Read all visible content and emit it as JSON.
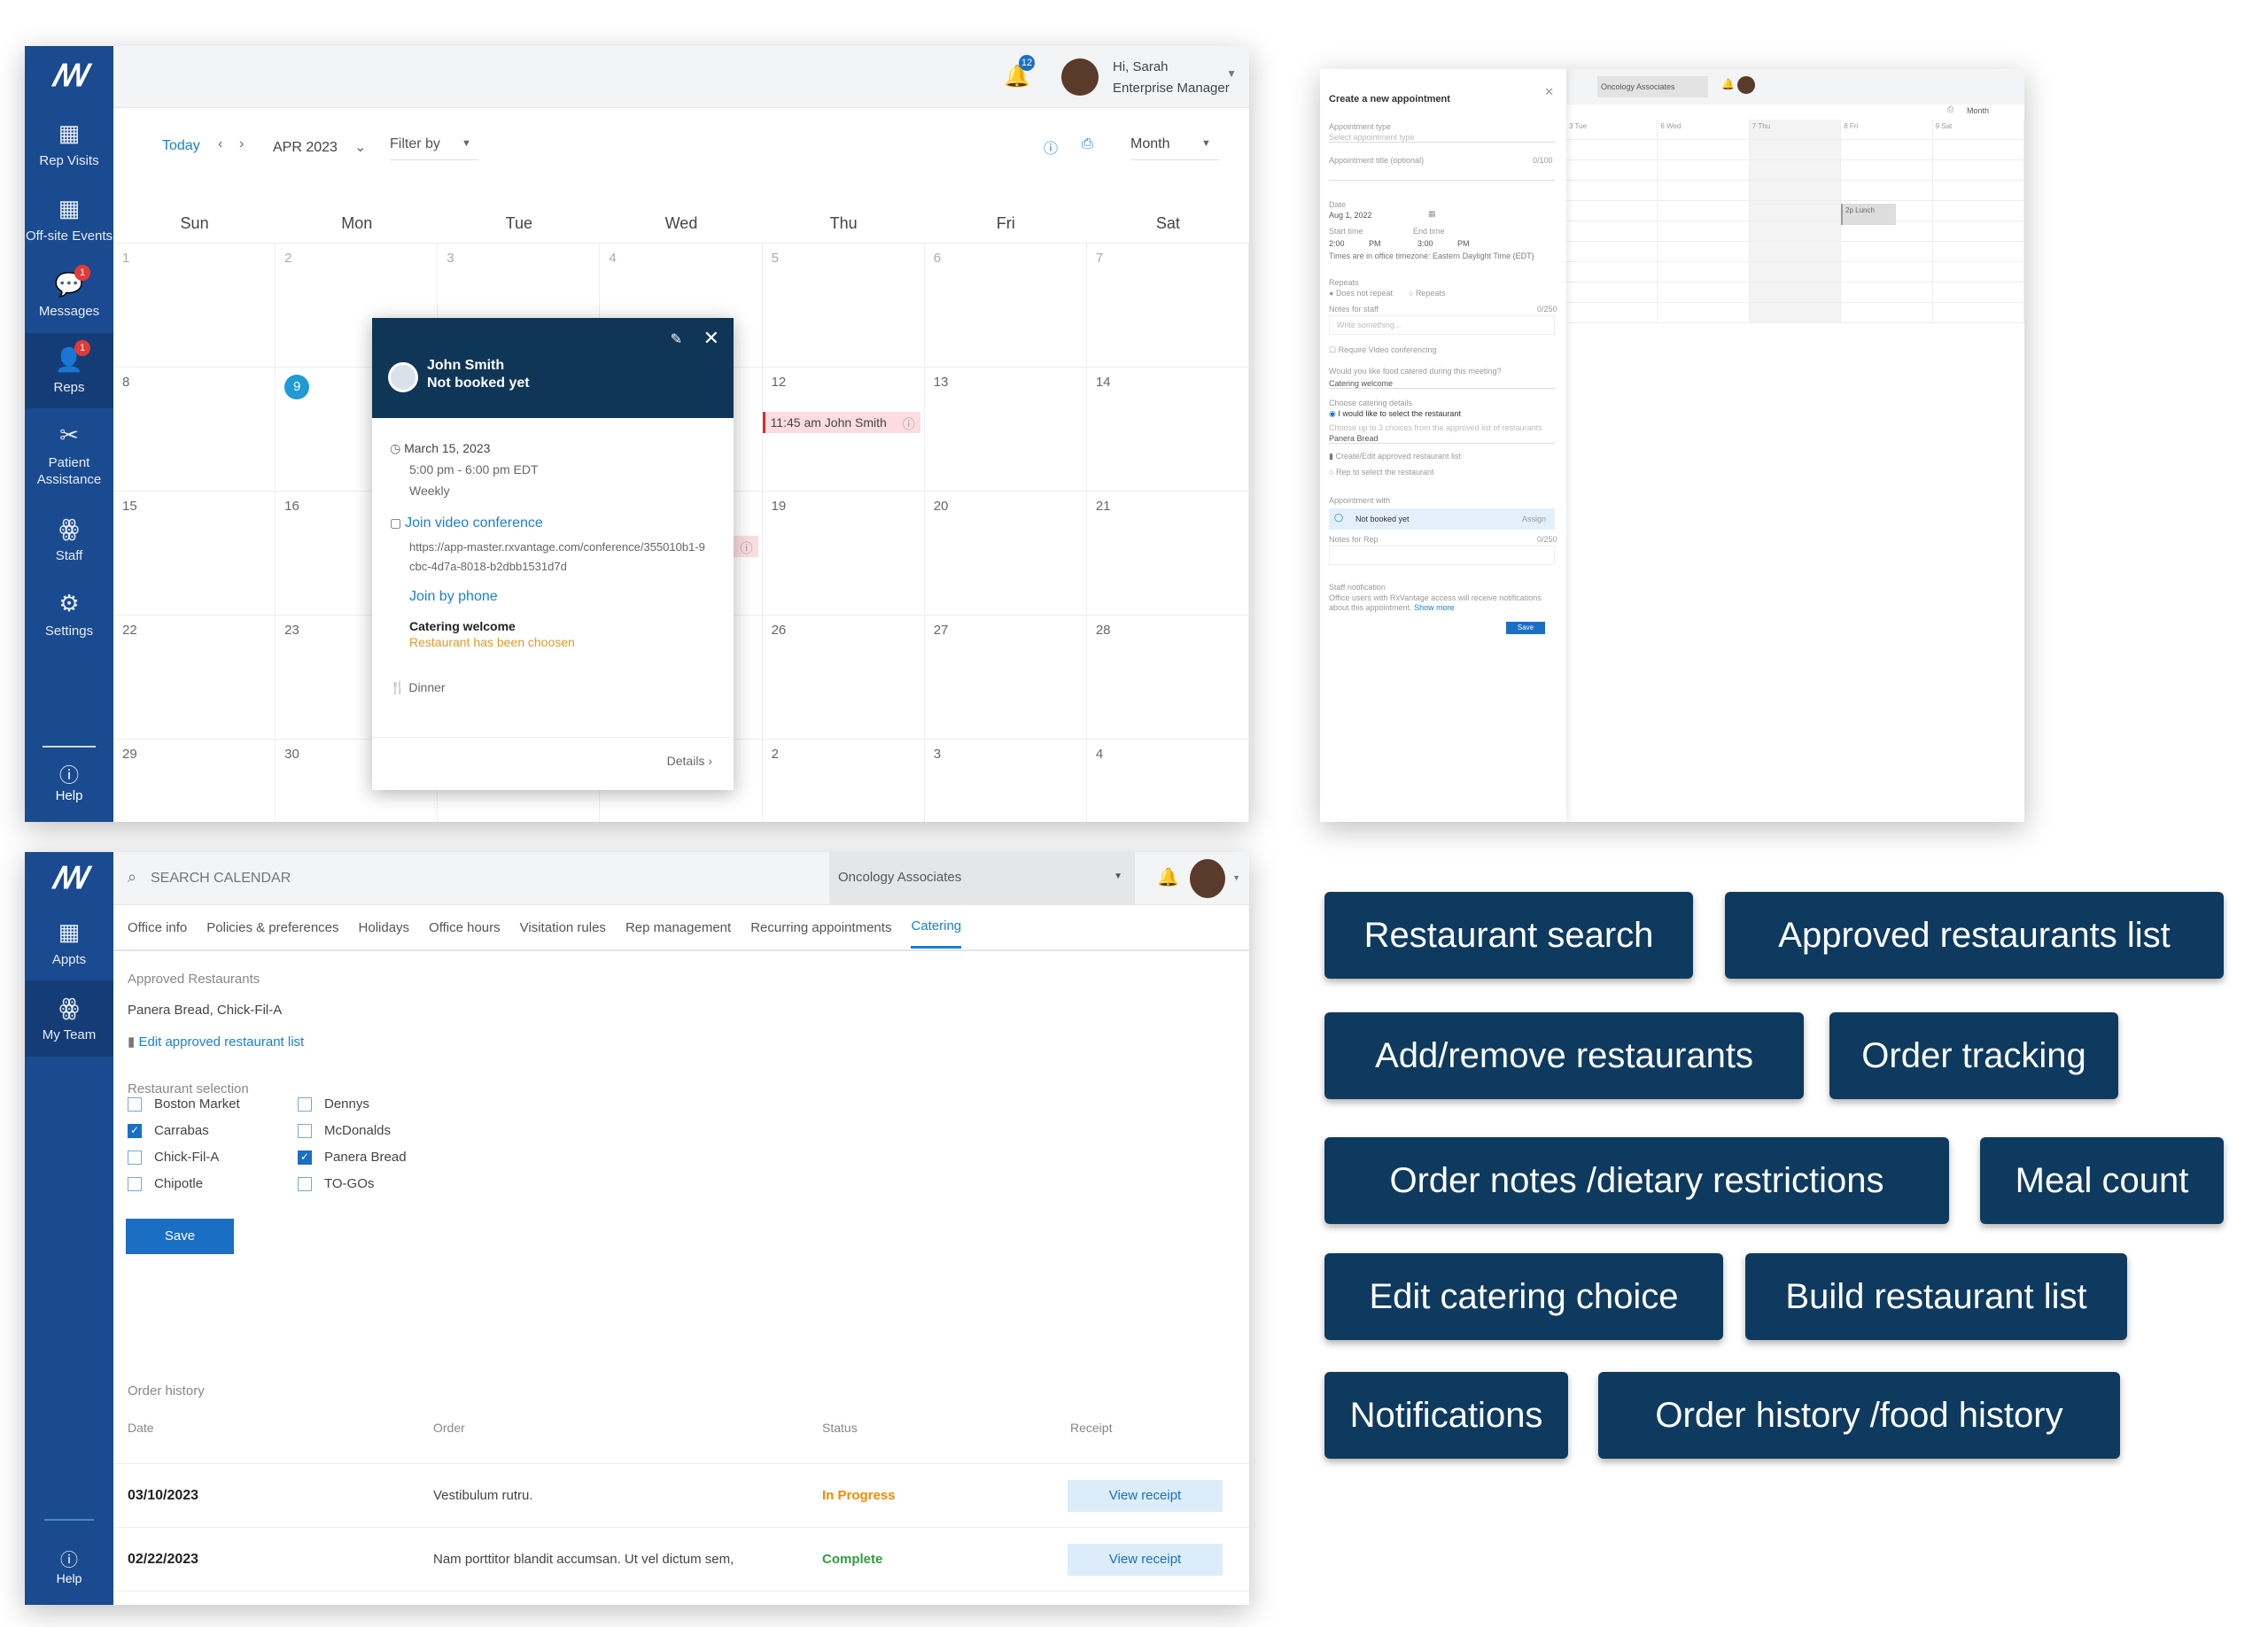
{
  "calendar": {
    "sidebar": [
      {
        "icon": "calendar-icon",
        "label": "Rep Visits"
      },
      {
        "icon": "calendar-icon",
        "label": "Off-site Events"
      },
      {
        "icon": "chat-icon",
        "label": "Messages",
        "badge": "1"
      },
      {
        "icon": "reps-icon",
        "label": "Reps",
        "badge": "1",
        "active": true
      },
      {
        "icon": "patient-icon",
        "label": "Patient Assistance"
      },
      {
        "icon": "staff-icon",
        "label": "Staff"
      },
      {
        "icon": "gear-icon",
        "label": "Settings"
      }
    ],
    "help": "Help",
    "notif_count": "12",
    "user": {
      "greeting": "Hi, Sarah",
      "role": "Enterprise Manager"
    },
    "toolbar": {
      "today": "Today",
      "month_label": "APR 2023",
      "filter": "Filter by",
      "view": "Month"
    },
    "days": [
      "Sun",
      "Mon",
      "Tue",
      "Wed",
      "Thu",
      "Fri",
      "Sat"
    ],
    "weeks": [
      [
        "1",
        "2",
        "3",
        "4",
        "5",
        "6",
        "7"
      ],
      [
        "8",
        "9",
        "",
        "",
        "12",
        "13",
        "14"
      ],
      [
        "15",
        "16",
        "",
        "",
        "19",
        "20",
        "21"
      ],
      [
        "22",
        "23",
        "",
        "",
        "26",
        "27",
        "28"
      ],
      [
        "29",
        "30",
        "",
        "",
        "2",
        "3",
        "4"
      ]
    ],
    "events": [
      {
        "week": 1,
        "day": 4,
        "text": "11:45 am John Smith"
      },
      {
        "week": 2,
        "day": 3,
        "text": "v..."
      }
    ],
    "popup": {
      "name": "John Smith",
      "status": "Not booked yet",
      "date": "March 15, 2023",
      "time": "5:00 pm - 6:00 pm EDT",
      "repeat": "Weekly",
      "video_link": "Join video conference",
      "url": "https://app-master.rxvantage.com/conference/355010b1-9cbc-4d7a-8018-b2dbb1531d7d",
      "phone_link": "Join by phone",
      "catering_title": "Catering welcome",
      "catering_status": "Restaurant has been choosen",
      "meal": "Dinner",
      "details": "Details"
    }
  },
  "appointment": {
    "title": "Create a new appointment",
    "type_label": "Appointment type",
    "type_placeholder": "Select appointment type",
    "title_label": "Appointment title (optional)",
    "title_count": "0/100",
    "date_label": "Date",
    "date": "Aug 1, 2022",
    "start_label": "Start time",
    "start": "2:00",
    "start_ampm": "PM",
    "end_label": "End time",
    "end": "3:00",
    "end_ampm": "PM",
    "tz_note": "Times are in office timezone: Eastern Daylight Time (EDT)",
    "repeats_label": "Repeats",
    "repeat_opt1": "Does not repeat",
    "repeat_opt2": "Repeats",
    "notes_label": "Notes for staff",
    "notes_count": "0/250",
    "notes_placeholder": "Write something...",
    "video_label": "Require Video conferencing",
    "food_q": "Would you like food catered during this meeting?",
    "food_value": "Catering welcome",
    "details_label": "Choose catering details",
    "opt_select": "I would like to select the restaurant",
    "choices_note": "Choose up to 3 choices from the approved list of restaurants",
    "restaurant": "Panera Bread",
    "edit_link": "Create/Edit approved restaurant list",
    "opt_rep": "Rep to select the restaurant",
    "with_label": "Appointment with",
    "not_booked": "Not booked yet",
    "assign": "Assign",
    "rep_notes_label": "Notes for Rep",
    "rep_notes_count": "0/250",
    "staff_label": "Staff notification",
    "staff_note": "Office users with RxVantage access will receive notifications about this appointment.",
    "show_more": "Show more",
    "save": "Save",
    "office": "Oncology Associates",
    "view": "Month",
    "cols": [
      "3 Tue",
      "6 Wed",
      "7 Thu",
      "8 Fri",
      "9 Sat"
    ],
    "event": "2p Lunch"
  },
  "catering": {
    "sidebar": [
      {
        "icon": "calendar-icon",
        "label": "Appts"
      },
      {
        "icon": "team-icon",
        "label": "My Team",
        "active": true
      }
    ],
    "help": "Help",
    "search_placeholder": "SEARCH CALENDAR",
    "office": "Oncology Associates",
    "tabs": [
      {
        "label": "Office info"
      },
      {
        "label": "Policies & preferences"
      },
      {
        "label": "Holidays"
      },
      {
        "label": "Office hours"
      },
      {
        "label": "Visitation rules"
      },
      {
        "label": "Rep management"
      },
      {
        "label": "Recurring appointments"
      },
      {
        "label": "Catering",
        "selected": true
      }
    ],
    "approved_label": "Approved Restaurants",
    "approved_value": "Panera Bread, Chick-Fil-A",
    "edit_link": "Edit approved restaurant list",
    "selection_label": "Restaurant selection",
    "restaurants_col1": [
      {
        "name": "Boston Market",
        "checked": false
      },
      {
        "name": "Carrabas",
        "checked": true
      },
      {
        "name": "Chick-Fil-A",
        "checked": false
      },
      {
        "name": "Chipotle",
        "checked": false
      }
    ],
    "restaurants_col2": [
      {
        "name": "Dennys",
        "checked": false
      },
      {
        "name": "McDonalds",
        "checked": false
      },
      {
        "name": "Panera Bread",
        "checked": true
      },
      {
        "name": "TO-GOs",
        "checked": false
      }
    ],
    "save": "Save",
    "history_label": "Order history",
    "columns": [
      "Date",
      "Order",
      "Status",
      "Receipt"
    ],
    "orders": [
      {
        "date": "03/10/2023",
        "order": "Vestibulum rutru.",
        "status": "In Progress",
        "status_color": "#f08a00",
        "receipt": "View receipt"
      },
      {
        "date": "02/22/2023",
        "order": "Nam porttitor blandit accumsan. Ut vel dictum sem,",
        "status": "Complete",
        "status_color": "#2e9e3e",
        "receipt": "View receipt"
      }
    ]
  },
  "features": [
    "Restaurant search",
    "Approved restaurants list",
    "Add/remove restaurants",
    "Order tracking",
    "Order notes /dietary restrictions",
    "Meal count",
    "Edit catering choice",
    "Build restaurant list",
    "Notifications",
    "Order history /food history"
  ],
  "colors": {
    "sidebar": "#1a4a8f",
    "accent": "#1a7fd0",
    "feature_tag": "#0f3a5f",
    "popup_header": "#0f3557"
  }
}
